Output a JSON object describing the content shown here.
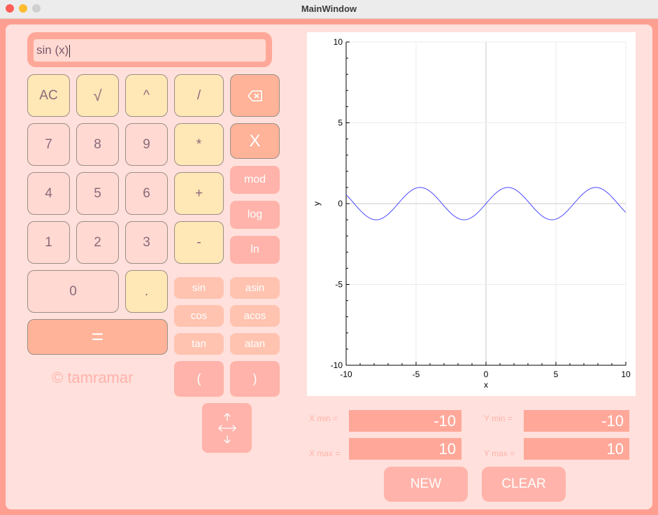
{
  "window": {
    "title": "MainWindow"
  },
  "display": {
    "expression": "sin (x)"
  },
  "keys": {
    "ac": "AC",
    "sqrt": "√",
    "pow": "^",
    "div": "/",
    "backspace_icon": "backspace-icon",
    "seven": "7",
    "eight": "8",
    "nine": "9",
    "mul": "*",
    "x": "X",
    "four": "4",
    "five": "5",
    "six": "6",
    "plus": "+",
    "mod": "mod",
    "log": "log",
    "one": "1",
    "two": "2",
    "three": "3",
    "minus": "-",
    "ln": "ln",
    "zero": "0",
    "dot": ".",
    "eq": "=",
    "sin": "sin",
    "asin": "asin",
    "cos": "cos",
    "acos": "acos",
    "tan": "tan",
    "atan": "atan",
    "lparen": "(",
    "rparen": ")",
    "move_icon": "move-arrows-icon"
  },
  "copyright": "© tamramar",
  "chart_data": {
    "type": "line",
    "function": "sin(x)",
    "xlabel": "x",
    "ylabel": "y",
    "xlim": [
      -10,
      10
    ],
    "ylim": [
      -10,
      10
    ],
    "xticks": [
      "-10",
      "-5",
      "0",
      "5",
      "10"
    ],
    "yticks": [
      "10",
      "5",
      "0",
      "-5",
      "-10"
    ],
    "grid": true,
    "line_color": "#4a4aff"
  },
  "range": {
    "xmin_label": "X min =",
    "xmin_value": "-10",
    "xmax_label": "X max =",
    "xmax_value": "10",
    "ymin_label": "Y min =",
    "ymin_value": "-10",
    "ymax_label": "Y max =",
    "ymax_value": "10"
  },
  "actions": {
    "new": "NEW",
    "clear": "CLEAR"
  }
}
